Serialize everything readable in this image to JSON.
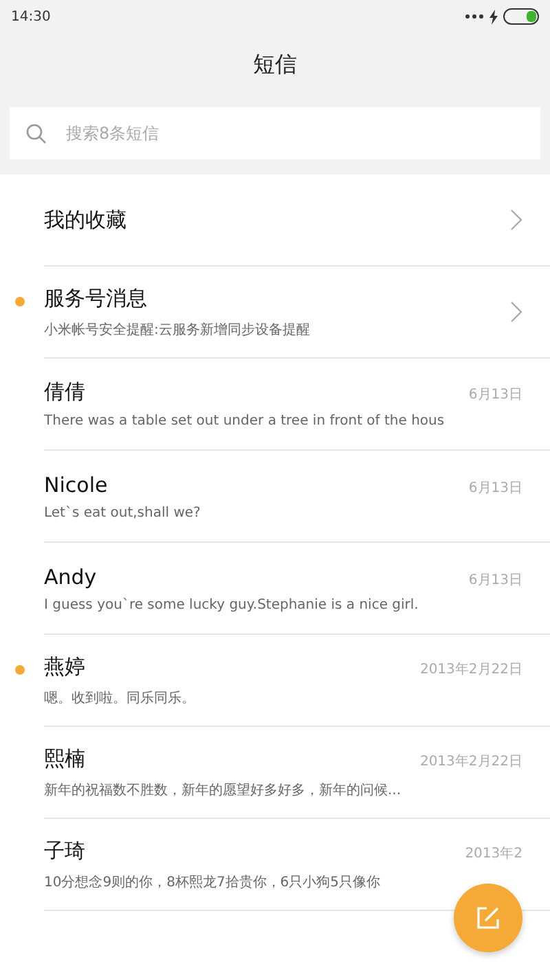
{
  "status_bar": {
    "time": "14:30"
  },
  "header": {
    "title": "短信"
  },
  "search": {
    "placeholder": "搜索8条短信"
  },
  "rows": [
    {
      "kind": "folder",
      "name": "我的收藏",
      "unread": false
    },
    {
      "kind": "service",
      "name": "服务号消息",
      "preview": "小米帐号安全提醒:云服务新增同步设备提醒",
      "unread": true
    },
    {
      "kind": "message",
      "name": "倩倩",
      "preview": "There was a table set out under a tree in front of the hous",
      "date": "6月13日",
      "unread": false
    },
    {
      "kind": "message",
      "name": "Nicole",
      "preview": "Let`s eat out,shall we?",
      "date": "6月13日",
      "unread": false
    },
    {
      "kind": "message",
      "name": "Andy",
      "preview": "I guess you`re some lucky guy.Stephanie is a nice girl.",
      "date": "6月13日",
      "unread": false
    },
    {
      "kind": "message",
      "name": "燕婷",
      "preview": "嗯。收到啦。同乐同乐。",
      "date": "2013年2月22日",
      "unread": true
    },
    {
      "kind": "message",
      "name": "熙楠",
      "preview": "新年的祝福数不胜数，新年的愿望好多好多，新年的问候...",
      "date": "2013年2月22日",
      "unread": false
    },
    {
      "kind": "message",
      "name": "子琦",
      "preview": "10分想念9则的你，8杯熙龙7拾贵你，6只小狗5只像你",
      "date": "2013年2",
      "unread": false
    }
  ]
}
